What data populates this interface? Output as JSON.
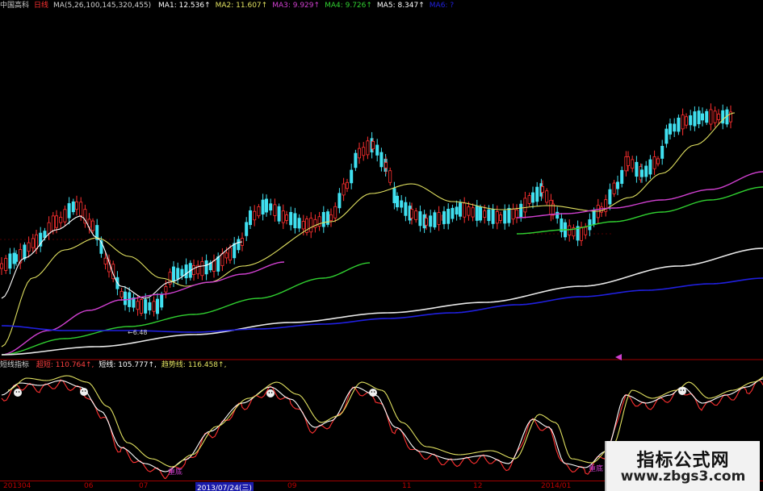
{
  "header": {
    "stock": "中国高科",
    "period": "日线",
    "ma_params": "MA(5,26,100,145,320,455)",
    "ma": [
      {
        "label": "MA1:",
        "value": "12.536",
        "color": "#ffffff"
      },
      {
        "label": "MA2:",
        "value": "11.607",
        "color": "#e0e060"
      },
      {
        "label": "MA3:",
        "value": "9.929",
        "color": "#d040d0"
      },
      {
        "label": "MA4:",
        "value": "9.726",
        "color": "#30d030"
      },
      {
        "label": "MA5:",
        "value": "8.347",
        "color": "#ffffff"
      },
      {
        "label": "MA6:",
        "value": "?",
        "color": "#2020e0"
      }
    ],
    "up_arrow": "↑"
  },
  "indicator": {
    "name": "短线指标",
    "items": [
      {
        "label": "超短:",
        "value": "110.764",
        "color": "#ff4040"
      },
      {
        "label": "短线:",
        "value": "105.777",
        "color": "#ffffff"
      },
      {
        "label": "趋势线:",
        "value": "116.458",
        "color": "#e0e060"
      }
    ],
    "markers": [
      "重底",
      "重底"
    ]
  },
  "min_label": "←6.48",
  "date_axis": {
    "labels": [
      "201304",
      "06",
      "07",
      "2013/07/24(三)",
      "09",
      "11",
      "12",
      "2014/01"
    ]
  },
  "watermark": {
    "line1": "指标公式网",
    "line2": "www.zbgs3.com"
  },
  "colors": {
    "up_candle": "#ff3030",
    "down_candle": "#40e0f0",
    "ma1": "#ffffff",
    "ma2": "#e0e060",
    "ma3": "#d040d0",
    "ma4": "#30d030",
    "ma5": "#e8e8e8",
    "ma6": "#2020e0",
    "osc_fast": "#ff3030",
    "osc_mid": "#ffffff",
    "osc_trend": "#e0e060"
  },
  "chart_data": [
    {
      "type": "line",
      "subtype": "candlestick-with-moving-averages",
      "title": "中国高科 日线",
      "x_labels": [
        "201304",
        "06",
        "07",
        "2013/07/24(三)",
        "09",
        "11",
        "12",
        "2014/01"
      ],
      "price_min_label": 6.48,
      "series": [
        {
          "name": "MA1",
          "last": 12.536
        },
        {
          "name": "MA2",
          "last": 11.607
        },
        {
          "name": "MA3",
          "last": 9.929
        },
        {
          "name": "MA4",
          "last": 9.726
        },
        {
          "name": "MA5",
          "last": 8.347
        }
      ]
    },
    {
      "type": "line",
      "title": "短线指标",
      "series": [
        {
          "name": "超短",
          "last": 110.764
        },
        {
          "name": "短线",
          "last": 105.777
        },
        {
          "name": "趋势线",
          "last": 116.458
        }
      ]
    }
  ]
}
